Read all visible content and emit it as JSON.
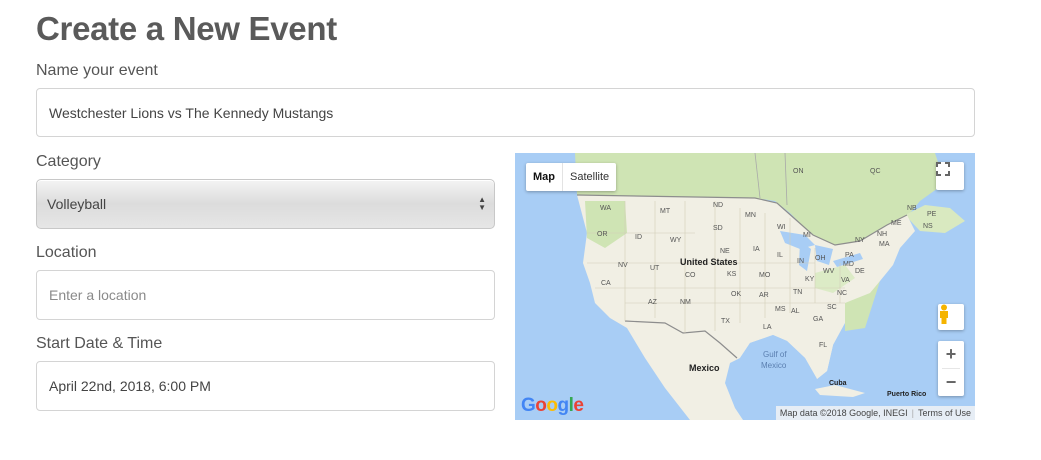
{
  "page": {
    "title": "Create a New Event"
  },
  "form": {
    "name": {
      "label": "Name your event",
      "value": "Westchester Lions vs The Kennedy Mustangs"
    },
    "category": {
      "label": "Category",
      "selected": "Volleyball"
    },
    "location": {
      "label": "Location",
      "placeholder": "Enter a location"
    },
    "start": {
      "label": "Start Date & Time",
      "value": "April 22nd, 2018, 6:00 PM"
    }
  },
  "map": {
    "type_buttons": {
      "map": "Map",
      "satellite": "Satellite"
    },
    "zoom_in": "+",
    "zoom_out": "−",
    "attribution": "Map data ©2018 Google, INEGI",
    "terms": "Terms of Use",
    "logo": {
      "g1": "G",
      "o1": "o",
      "o2": "o",
      "g2": "g",
      "l": "l",
      "e": "e"
    },
    "labels": {
      "on": "ON",
      "qc": "QC",
      "wa": "WA",
      "mt": "MT",
      "nd": "ND",
      "mn": "MN",
      "nb": "NB",
      "pe": "PE",
      "me": "ME",
      "ns": "NS",
      "or": "OR",
      "id": "ID",
      "sd": "SD",
      "wi": "WI",
      "mi": "MI",
      "wy": "WY",
      "ny": "NY",
      "nh": "NH",
      "ma": "MA",
      "ia": "IA",
      "ne": "NE",
      "pa": "PA",
      "il": "IL",
      "oh": "OH",
      "nv": "NV",
      "ut": "UT",
      "in": "IN",
      "md": "MD",
      "us": "United States",
      "co": "CO",
      "ks": "KS",
      "mo": "MO",
      "wv": "WV",
      "de": "DE",
      "ky": "KY",
      "va": "VA",
      "ca": "CA",
      "ok": "OK",
      "ar": "AR",
      "tn": "TN",
      "nc": "NC",
      "az": "AZ",
      "nm": "NM",
      "sc": "SC",
      "ms": "MS",
      "al": "AL",
      "ga": "GA",
      "tx": "TX",
      "la": "LA",
      "fl": "FL",
      "gulf1": "Gulf of",
      "gulf2": "Mexico",
      "mexico": "Mexico",
      "cuba": "Cuba",
      "pr": "Puerto Rico"
    }
  },
  "colors": {
    "water": "#a8cdf5",
    "land": "#f1efe4",
    "forest": "#cfe4b4",
    "border": "#8d8d8d"
  }
}
